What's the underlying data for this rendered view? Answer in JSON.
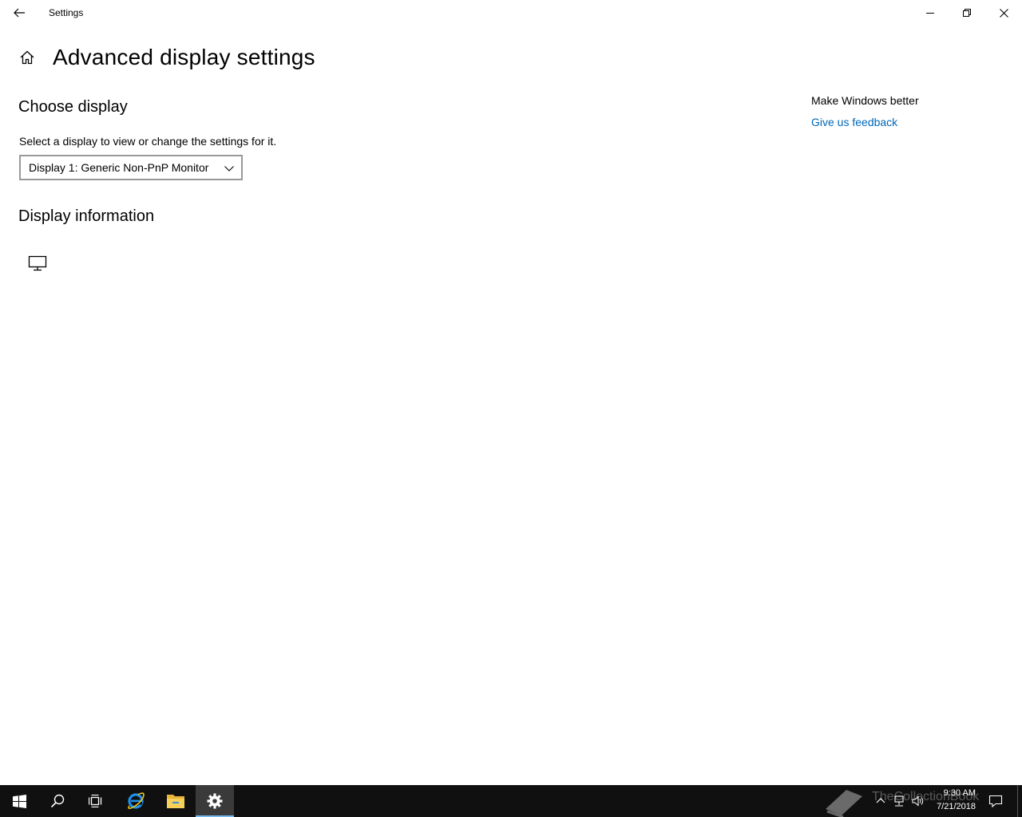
{
  "window": {
    "title": "Settings"
  },
  "page": {
    "title": "Advanced display settings"
  },
  "choose_display": {
    "heading": "Choose display",
    "description": "Select a display to view or change the settings for it.",
    "dropdown_value": "Display 1: Generic Non-PnP Monitor"
  },
  "display_information": {
    "heading": "Display information"
  },
  "right_column": {
    "title": "Make Windows better",
    "link": "Give us feedback"
  },
  "taskbar": {
    "time": "9:30 AM",
    "date": "7/21/2018",
    "watermark": "TheCollectionBook",
    "active_app": "settings"
  },
  "colors": {
    "link": "#0067b8",
    "taskbar": "#101010",
    "active_indicator": "#76b9ed"
  },
  "icons": [
    "back-icon",
    "minimize-icon",
    "maximize-icon",
    "close-icon",
    "home-icon",
    "chevron-down-icon",
    "monitor-icon",
    "windows-start-icon",
    "search-icon",
    "task-view-icon",
    "ie-icon",
    "file-explorer-icon",
    "settings-gear-icon",
    "chevron-up-icon",
    "network-icon",
    "volume-icon",
    "notification-icon"
  ]
}
